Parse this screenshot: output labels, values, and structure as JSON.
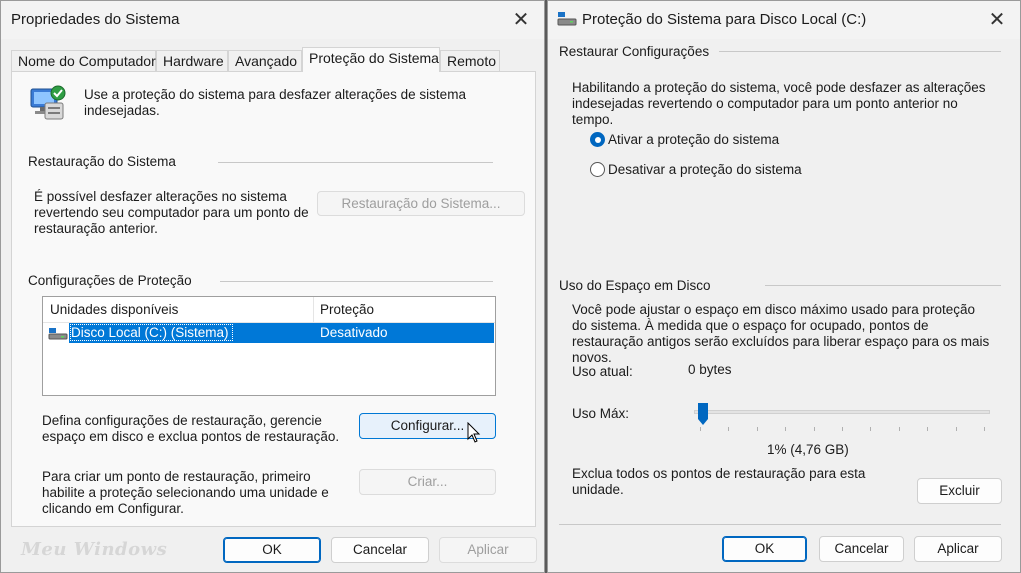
{
  "window1": {
    "title": "Propriedades do Sistema",
    "close_label": "✕",
    "tabs": [
      {
        "label": "Nome do Computador"
      },
      {
        "label": "Hardware"
      },
      {
        "label": "Avançado"
      },
      {
        "label": "Proteção do Sistema",
        "active": true
      },
      {
        "label": "Remoto"
      }
    ],
    "intro_text": "Use a proteção do sistema para desfazer alterações de sistema indesejadas.",
    "restore_group": {
      "label": "Restauração do Sistema",
      "description": "É possível desfazer alterações no sistema revertendo seu computador para um ponto de restauração anterior.",
      "button_label": "Restauração do Sistema..."
    },
    "protection_group": {
      "label": "Configurações de Proteção",
      "columns": [
        "Unidades disponíveis",
        "Proteção"
      ],
      "rows": [
        {
          "drive": "Disco Local (C:) (Sistema)",
          "protection": "Desativado"
        }
      ],
      "configure_text": "Defina configurações de restauração, gerencie espaço em disco e exclua pontos de restauração.",
      "configure_button": "Configurar...",
      "create_text": "Para criar um ponto de restauração, primeiro habilite a proteção selecionando uma unidade e clicando em Configurar.",
      "create_button": "Criar..."
    },
    "watermark": "Meu Windows",
    "buttons": {
      "ok": "OK",
      "cancel": "Cancelar",
      "apply": "Aplicar"
    }
  },
  "window2": {
    "title": "Proteção do Sistema para Disco Local (C:)",
    "close_label": "✕",
    "restore_settings": {
      "label": "Restaurar Configurações",
      "description": "Habilitando a proteção do sistema, você pode desfazer as alterações indesejadas revertendo o computador para um ponto anterior no tempo.",
      "option_on": "Ativar a proteção do sistema",
      "option_off": "Desativar a proteção do sistema",
      "selected": "option_on"
    },
    "disk_usage": {
      "label": "Uso do Espaço em Disco",
      "description": "Você pode ajustar o espaço em disco máximo usado para proteção do sistema. À medida que o espaço for ocupado, pontos de restauração antigos serão excluídos para liberar espaço para os mais novos.",
      "current_label": "Uso atual:",
      "current_value": "0 bytes",
      "max_label": "Uso Máx:",
      "max_percent": 1,
      "max_value_text": "1% (4,76 GB)",
      "delete_text": "Exclua todos os pontos de restauração para esta unidade.",
      "delete_button": "Excluir"
    },
    "buttons": {
      "ok": "OK",
      "cancel": "Cancelar",
      "apply": "Aplicar"
    }
  },
  "colors": {
    "accent": "#0067c0",
    "selection": "#0078d7",
    "window_bg": "#f0f0f0"
  },
  "icons": [
    "system-protection-icon",
    "drive-icon",
    "cursor-arrow-icon",
    "disk-title-icon"
  ]
}
